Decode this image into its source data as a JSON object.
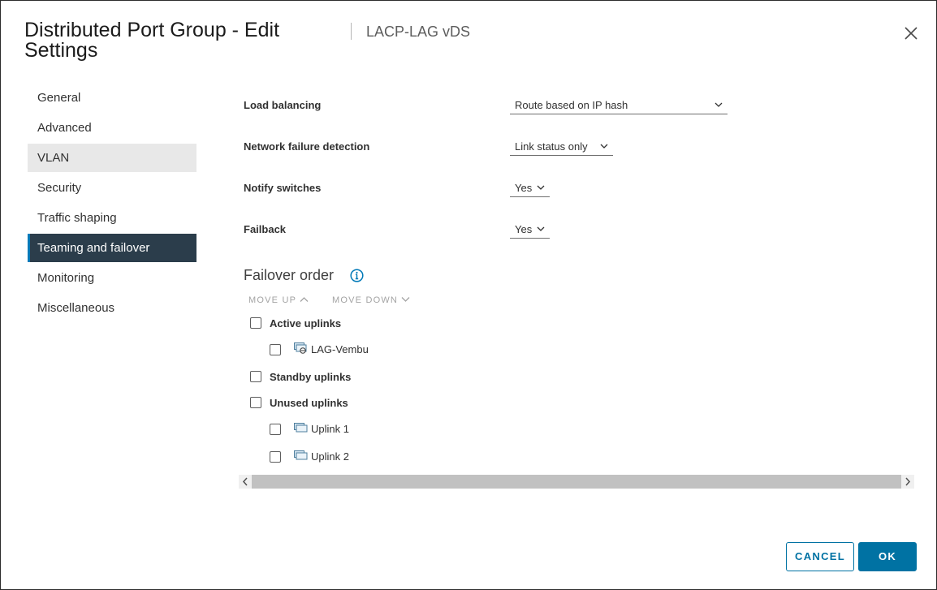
{
  "dialog": {
    "title": "Distributed Port Group - Edit Settings",
    "subtitle": "LACP-LAG vDS"
  },
  "nav": {
    "items": [
      {
        "label": "General"
      },
      {
        "label": "Advanced"
      },
      {
        "label": "VLAN"
      },
      {
        "label": "Security"
      },
      {
        "label": "Traffic shaping"
      },
      {
        "label": "Teaming and failover"
      },
      {
        "label": "Monitoring"
      },
      {
        "label": "Miscellaneous"
      }
    ],
    "active": "Teaming and failover",
    "hovered": "VLAN"
  },
  "fields": {
    "load_balancing": {
      "label": "Load balancing",
      "value": "Route based on IP hash"
    },
    "network_failure_detection": {
      "label": "Network failure detection",
      "value": "Link status only"
    },
    "notify_switches": {
      "label": "Notify switches",
      "value": "Yes"
    },
    "failback": {
      "label": "Failback",
      "value": "Yes"
    }
  },
  "failover": {
    "title": "Failover order",
    "move_up": "MOVE UP",
    "move_down": "MOVE DOWN",
    "groups": {
      "active": {
        "label": "Active uplinks",
        "items": [
          "LAG-Vembu"
        ]
      },
      "standby": {
        "label": "Standby uplinks",
        "items": []
      },
      "unused": {
        "label": "Unused uplinks",
        "items": [
          "Uplink 1",
          "Uplink 2"
        ]
      }
    }
  },
  "buttons": {
    "cancel": "CANCEL",
    "ok": "OK"
  },
  "colors": {
    "accent": "#0072a3",
    "nav_active_bg": "#2b3d4b",
    "nav_hover_bg": "#e8e8e8"
  }
}
